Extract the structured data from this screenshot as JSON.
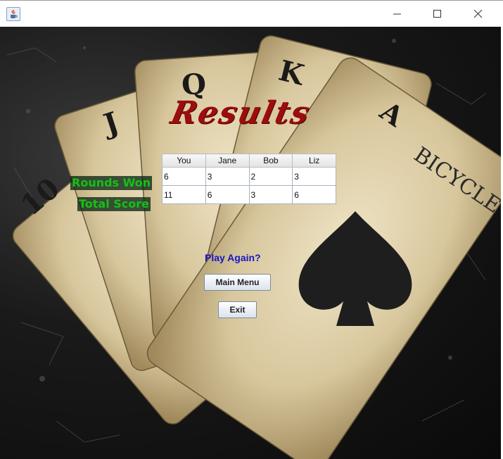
{
  "window": {
    "app_icon": "java-cup-icon",
    "controls": [
      "minimize-icon",
      "maximize-icon",
      "close-icon"
    ]
  },
  "results": {
    "title": "Results",
    "row_labels": [
      "Rounds Won",
      "Total Score"
    ],
    "columns": [
      "You",
      "Jane",
      "Bob",
      "Liz"
    ],
    "rows": [
      [
        "6",
        "3",
        "2",
        "3"
      ],
      [
        "11",
        "6",
        "3",
        "6"
      ]
    ]
  },
  "actions": {
    "prompt": "Play Again?",
    "main_menu_label": "Main Menu",
    "exit_label": "Exit"
  },
  "colors": {
    "title": "#9c0d0d",
    "labels": "#16c016",
    "prompt": "#1515c8"
  }
}
